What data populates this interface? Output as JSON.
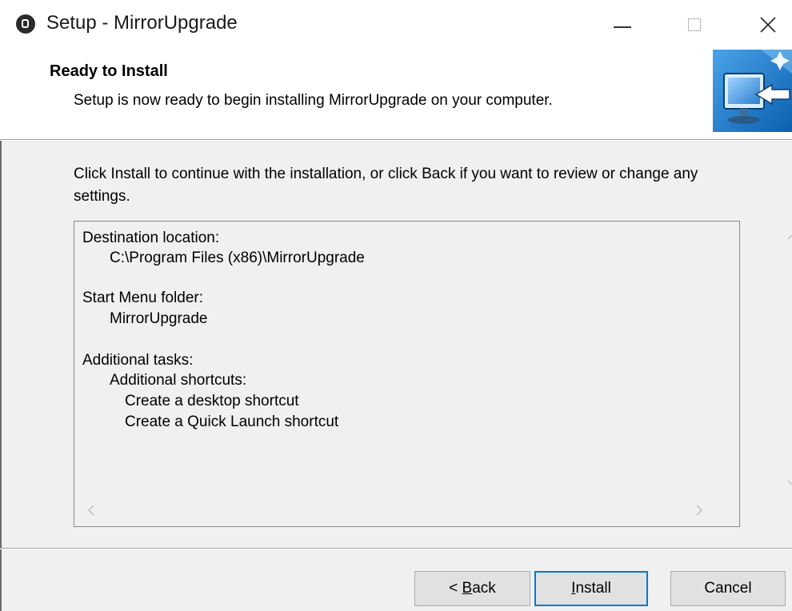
{
  "window": {
    "title": "Setup - MirrorUpgrade"
  },
  "header": {
    "title": "Ready to Install",
    "subtitle": "Setup is now ready to begin installing MirrorUpgrade on your computer."
  },
  "intro": "Click Install to continue with the installation, or click Back if you want to review or change any settings.",
  "memo": {
    "lines": [
      "Destination location:",
      "C:\\Program Files (x86)\\MirrorUpgrade",
      "Start Menu folder:",
      "MirrorUpgrade",
      "Additional tasks:",
      "Additional shortcuts:",
      "Create a desktop shortcut",
      "Create a Quick Launch shortcut"
    ]
  },
  "buttons": {
    "back_prefix": "< ",
    "back_access": "B",
    "back_rest": "ack",
    "install_access": "I",
    "install_rest": "nstall",
    "cancel": "Cancel"
  },
  "icons": {
    "app": "app-icon",
    "minimize": "minimize-icon",
    "maximize": "maximize-icon",
    "close": "close-icon",
    "wizard": "computer-install-icon",
    "scroll_up": "chevron-up-icon",
    "scroll_down": "chevron-down-icon",
    "scroll_left": "chevron-left-icon",
    "scroll_right": "chevron-right-icon"
  },
  "colors": {
    "default_button_border": "#0078d7",
    "wizard_blue": "#1e7fd0"
  }
}
